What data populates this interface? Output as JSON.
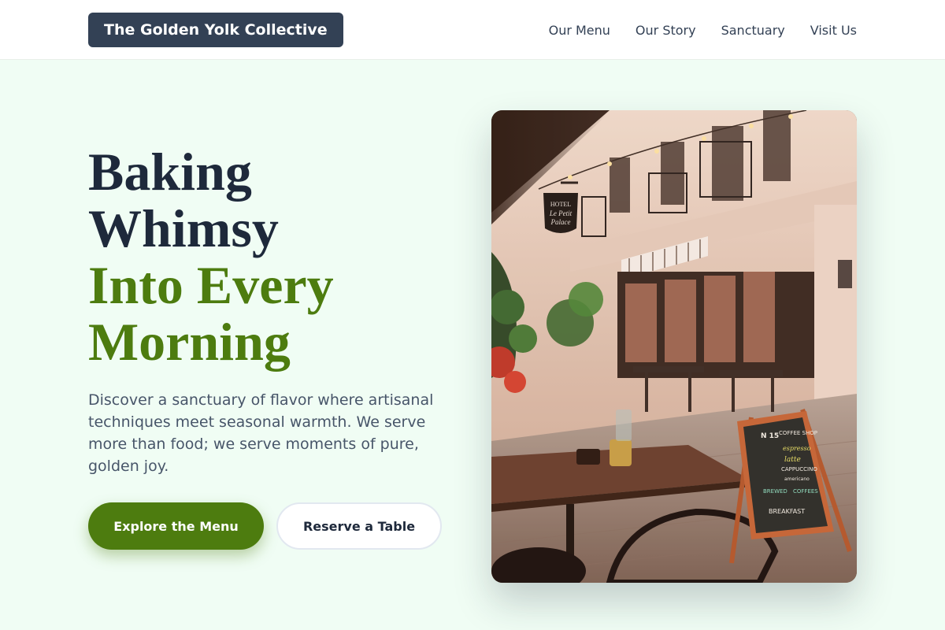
{
  "header": {
    "logo_text": "The Golden Yolk Collective",
    "nav": [
      {
        "label": "Our Menu"
      },
      {
        "label": "Our Story"
      },
      {
        "label": "Sanctuary"
      },
      {
        "label": "Visit Us"
      }
    ]
  },
  "hero": {
    "title_line1": "Baking",
    "title_line2": "Whimsy",
    "title_line3": "Into Every",
    "title_line4": "Morning",
    "description": "Discover a sanctuary of flavor where artisanal techniques meet seasonal warmth. We serve more than food; we serve moments of pure, golden joy.",
    "primary_button": "Explore the Menu",
    "secondary_button": "Reserve a Table",
    "image": {
      "hotel_sign_line1": "HOTEL",
      "hotel_sign_line2": "Le Petit",
      "hotel_sign_line3": "Palace",
      "chalkboard_number": "N 15",
      "chalkboard_lines": [
        "COFFEE SHOP",
        "espresso",
        "latte",
        "CAPPUCCINO",
        "americano",
        "BREWED",
        "COFFEES",
        "BREAKFAST"
      ]
    }
  },
  "colors": {
    "background": "#f0fdf4",
    "brand_dark": "#334155",
    "accent_green": "#4d7c0f",
    "text_dark": "#1e293b"
  }
}
